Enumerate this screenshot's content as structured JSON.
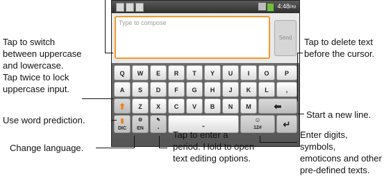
{
  "status_bar": {
    "time": "4:48",
    "time_suffix": "PM"
  },
  "compose": {
    "placeholder": "Type to compose",
    "send_label": "Send"
  },
  "keyboard": {
    "row1": [
      "Q",
      "W",
      "E",
      "R",
      "T",
      "Y",
      "U",
      "I",
      "O",
      "P"
    ],
    "row2": [
      "A",
      "S",
      "D",
      "F",
      "G",
      "H",
      "J",
      "K",
      "L",
      ","
    ],
    "row3": [
      "Z",
      "X",
      "C",
      "V",
      "B",
      "N",
      "M"
    ],
    "shift_symbol": "⬆",
    "delete_symbol": "⬅",
    "enter_symbol": "↵",
    "dic_label": "DIC",
    "lang_label": "EN",
    "period_symbol": ".",
    "num_label": "12#",
    "emoticon_symbol": "☺"
  },
  "annotations": {
    "switch_case": [
      "Tap to switch",
      "between uppercase",
      "and lowercase."
    ],
    "lock_upper": [
      "Tap twice to lock",
      "uppercase input."
    ],
    "word_prediction": "Use word prediction.",
    "change_language": "Change language.",
    "period_options": [
      "Tap to enter a",
      "period. Hold to open",
      "text editing options."
    ],
    "delete_text": [
      "Tap to delete text",
      "before the cursor."
    ],
    "new_line": "Start a new line.",
    "digits_symbols": [
      "Enter digits, symbols,",
      "emoticons and other",
      "pre-defined texts."
    ]
  }
}
